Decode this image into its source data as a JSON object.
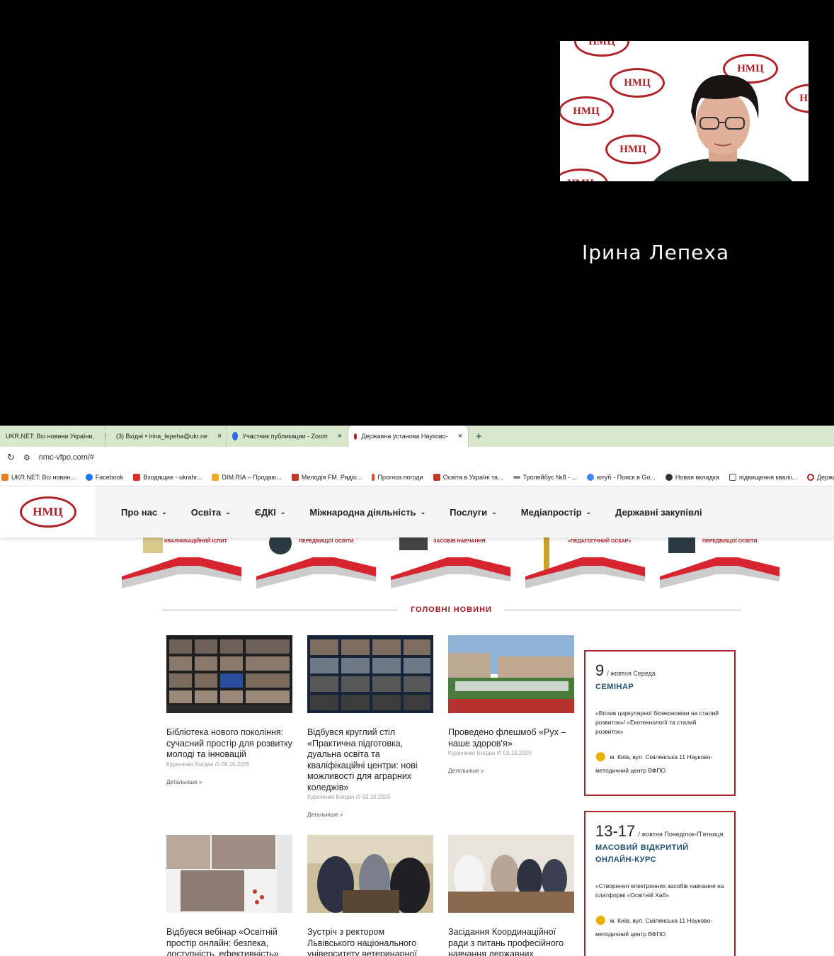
{
  "zoom": {
    "speaker_name": "Ірина Лепеха",
    "backdrop_logo_text": "НМЦ"
  },
  "browser": {
    "tabs": [
      {
        "label": "UKR.NET: Всі новини України,",
        "active": false
      },
      {
        "label": "(3) Вхідні • irina_lepeha@ukr.ne",
        "active": false
      },
      {
        "label": "Участник публикации - Zoom",
        "active": false
      },
      {
        "label": "Державна установа Науково-",
        "active": true
      }
    ],
    "new_tab": "+",
    "close": "×",
    "url": "nmc-vfpo.com/#",
    "bookmarks": [
      {
        "label": "UKR.NET: Всі новин...",
        "icon": "ukrnet-icon",
        "color": "#e67e22"
      },
      {
        "label": "Facebook",
        "icon": "facebook-icon",
        "color": "#1877f2"
      },
      {
        "label": "Входящие - ukrahr...",
        "icon": "gmail-icon",
        "color": "#d93025"
      },
      {
        "label": "DIM.RIA – Продаю...",
        "icon": "dimria-icon",
        "color": "#f5a623"
      },
      {
        "label": "Мелодія FM. Радіо...",
        "icon": "melodia-icon",
        "color": "#c0392b"
      },
      {
        "label": "Прогноз погоди",
        "icon": "thermometer-icon",
        "color": "#e74c3c"
      },
      {
        "label": "Освіта в Україні та...",
        "icon": "osvita-icon",
        "color": "#c0392b"
      },
      {
        "label": "Тролейбус №8 - ...",
        "icon": "trolleybus-icon",
        "color": "#7f8c8d"
      },
      {
        "label": "ютуб - Поиск в Go...",
        "icon": "google-icon",
        "color": "#4285f4"
      },
      {
        "label": "Новая вкладка",
        "icon": "globe-icon",
        "color": "#333333"
      },
      {
        "label": "підвищення кваліі...",
        "icon": "folder-icon",
        "color": "#555555"
      },
      {
        "label": "Державна",
        "icon": "nmc-icon",
        "color": "#b0222a"
      }
    ]
  },
  "site": {
    "logo_text": "НМЦ",
    "nav": [
      "Про нас",
      "Освіта",
      "ЄДКІ",
      "Міжнародна діяльність",
      "Послуги",
      "Медіапростір",
      "Державні закупівлі"
    ],
    "banners": [
      "КВАЛІФІКАЦІЙНИЙ ІСПИТ",
      "ПЕРЕДВИЩОЇ ОСВІТИ",
      "ЗАСОБІВ НАВЧАННЯ",
      "«ПЕДАГОГІЧНИЙ ОСКАР»",
      "ПЕРЕДВИЩОЇ ОСВІТИ"
    ],
    "section_title": "ГОЛОВНІ НОВИНИ",
    "news": [
      {
        "title": "Бібліотека нового покоління: сучасний простір для розвитку молоді та інновацій",
        "meta": "Кураченко Богдан /// 08.10.2025",
        "more": "Детальніше »"
      },
      {
        "title": "Відбувся круглий стіл «Практична підготовка, дуальна освіта та кваліфікаційні центри: нові можливості для аграрних коледжів»",
        "meta": "Кураченко Богдан /// 03.10.2025",
        "more": "Детальніше »"
      },
      {
        "title": "Проведено флешмоб «Рух – наше здоров'я»",
        "meta": "Кураченко Богдан /// 03.10.2025",
        "more": "Детальніше »"
      },
      {
        "title": "Відбувся вебінар «Освітній простір онлайн: безпека, доступність, ефективність»",
        "meta": "",
        "more": ""
      },
      {
        "title": "Зустріч з ректором Львівського національного університету ветеринарної",
        "meta": "",
        "more": ""
      },
      {
        "title": "Засідання Координаційної ради з питань професійного навчання державних",
        "meta": "",
        "more": ""
      }
    ],
    "events": [
      {
        "day": "9",
        "month": "/ жовтня Середа",
        "type": "СЕМІНАР",
        "desc": "«Вплив циркулярної біоекономіки на сталий розвиток»/ «Екотехнології та сталий розвиток»",
        "location": "м. Київ, вул. Смілянська 11 Науково-методичний центр ВФПО"
      },
      {
        "day": "13-17",
        "month": "/ жовтня Понеділок-П'ятниця",
        "type": "МАСОВИЙ ВІДКРИТИЙ ОНЛАЙН-КУРС",
        "desc": "«Створення електронних засобів навчання на платформі «Освітній Хаб»",
        "location": "м. Київ, вул. Смілянська 11 Науково-методичний центр ВФПО"
      }
    ]
  }
}
